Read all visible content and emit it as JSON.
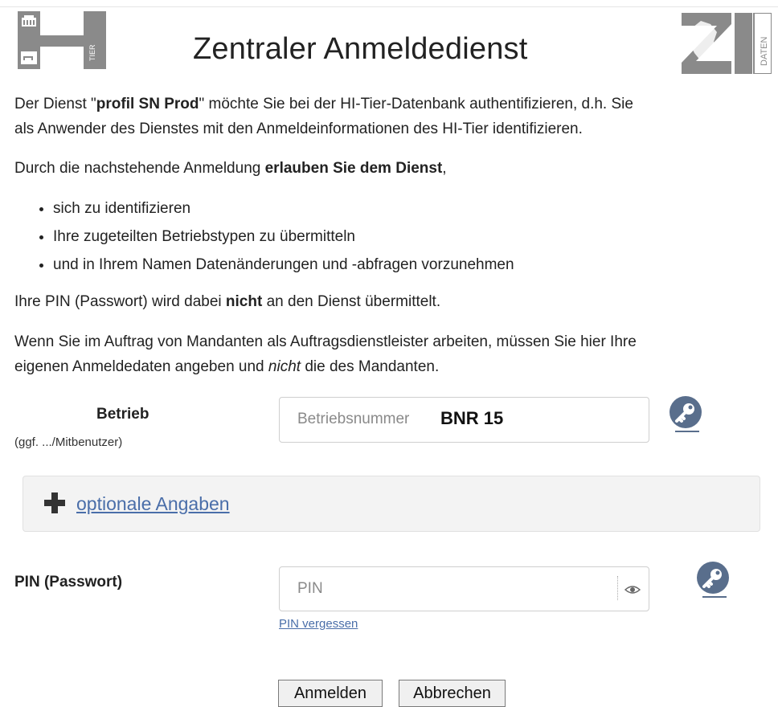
{
  "header": {
    "title": "Zentraler Anmeldedienst",
    "logo_left_label": "TIER",
    "logo_right_label": "DATEN"
  },
  "intro": {
    "p1_a": "Der Dienst \"",
    "p1_service": "profil SN Prod",
    "p1_b": "\" möchte Sie bei der HI-Tier-Datenbank authentifizieren, d.h. Sie",
    "p1_c": "als Anwender des Dienstes mit den Anmeldeinformationen des HI-Tier identifizieren.",
    "p2_a": "Durch die nachstehende Anmeldung ",
    "p2_bold": "erlauben Sie dem Dienst",
    "p2_b": ",",
    "bullets": [
      "sich zu identifizieren",
      "Ihre zugeteilten Betriebstypen zu übermitteln",
      "und in Ihrem Namen Datenänderungen und -abfragen vorzunehmen"
    ],
    "p3_a": "Ihre PIN (Passwort) wird dabei ",
    "p3_bold": "nicht",
    "p3_b": " an den Dienst übermittelt.",
    "p4_a": "Wenn Sie im Auftrag von Mandanten als Auftragsdienstleister arbeiten, müssen Sie hier Ihre",
    "p4_b": "eigenen Anmeldedaten angeben und ",
    "p4_italic": "nicht",
    "p4_c": " die des Mandanten."
  },
  "form": {
    "betrieb_label": "Betrieb",
    "betrieb_hint": "(ggf. .../Mitbenutzer)",
    "betrieb_placeholder": "Betriebsnummer",
    "betrieb_value": "BNR 15",
    "optional_label": "optionale Angaben",
    "pin_label": "PIN (Passwort)",
    "pin_placeholder": "PIN",
    "pin_forgot": "PIN vergessen",
    "login_button": "Anmelden",
    "cancel_button": "Abbrechen"
  },
  "colors": {
    "link": "#4a6ea9",
    "logo_gray": "#8a8a8a"
  }
}
